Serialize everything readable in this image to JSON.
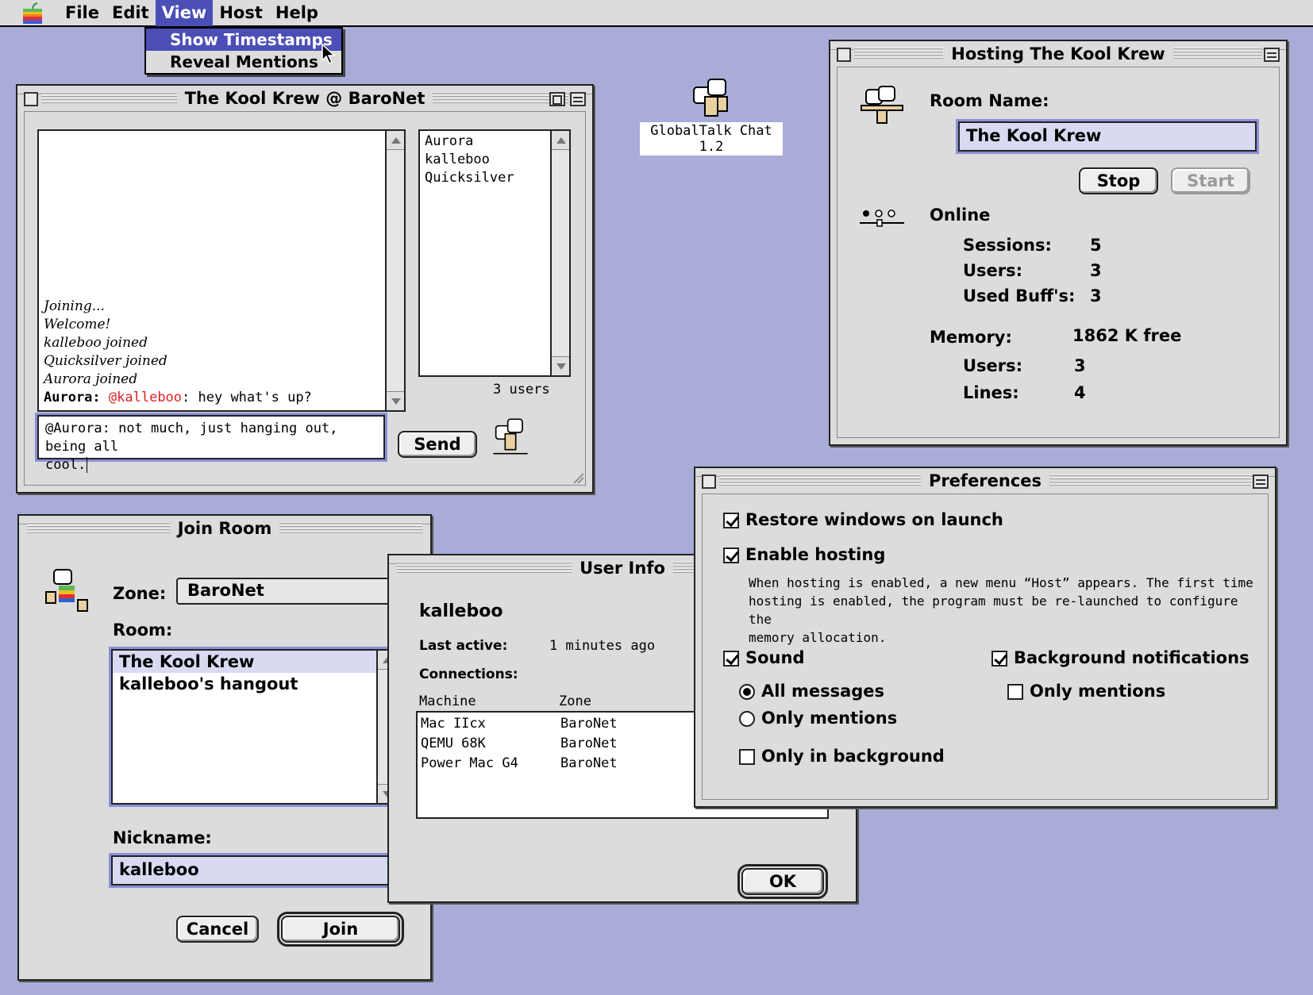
{
  "menubar": {
    "items": [
      "File",
      "Edit",
      "View",
      "Host",
      "Help"
    ],
    "active": "View",
    "view_menu": [
      "Show Timestamps",
      "Reveal Mentions"
    ]
  },
  "desktop_icon": {
    "label": "GlobalTalk Chat 1.2"
  },
  "chat_window": {
    "title": "The Kool Krew @ BaroNet",
    "log": [
      "Joining...",
      "Welcome!",
      "kalleboo joined",
      "Quicksilver joined",
      "Aurora joined"
    ],
    "last_message": {
      "sender": "Aurora:",
      "mention": "@kalleboo",
      "text": ": hey what's up?"
    },
    "users": [
      "Aurora",
      "kalleboo",
      "Quicksilver"
    ],
    "user_count": "3 users",
    "input_line1": "@Aurora: not much, just hanging out, being all",
    "input_line2": "cool.",
    "send_label": "Send"
  },
  "host_window": {
    "title": "Hosting The Kool Krew",
    "room_name_label": "Room Name:",
    "room_name_value": "The Kool Krew",
    "stop_label": "Stop",
    "start_label": "Start",
    "online_label": "Online",
    "sessions_label": "Sessions:",
    "sessions_value": "5",
    "users_label": "Users:",
    "users_value": "3",
    "buffs_label": "Used Buff's:",
    "buffs_value": "3",
    "memory_label": "Memory:",
    "memory_value": "1862 K free",
    "mem_users_label": "Users:",
    "mem_users_value": "3",
    "lines_label": "Lines:",
    "lines_value": "4"
  },
  "join_window": {
    "title": "Join Room",
    "zone_label": "Zone:",
    "zone_value": "BaroNet",
    "room_label": "Room:",
    "rooms": [
      "The Kool Krew",
      "kalleboo's hangout"
    ],
    "nickname_label": "Nickname:",
    "nickname_value": "kalleboo",
    "cancel_label": "Cancel",
    "join_label": "Join"
  },
  "userinfo_window": {
    "title": "User Info",
    "user": "kalleboo",
    "last_active_label": "Last active:",
    "last_active_value": "1 minutes ago",
    "connections_label": "Connections:",
    "col_machine": "Machine",
    "col_zone": "Zone",
    "rows": [
      [
        "Mac IIcx",
        "BaroNet"
      ],
      [
        "QEMU 68K",
        "BaroNet"
      ],
      [
        "Power Mac G4",
        "BaroNet"
      ]
    ],
    "ok_label": "OK"
  },
  "prefs_window": {
    "title": "Preferences",
    "restore_label": "Restore windows on launch",
    "hosting_label": "Enable hosting",
    "hosting_note_1": "When hosting is enabled, a new menu “Host” appears. The first time",
    "hosting_note_2": "hosting is enabled, the program must be re-launched to configure the",
    "hosting_note_3": "memory allocation.",
    "sound_label": "Sound",
    "all_messages_label": "All messages",
    "only_mentions_label": "Only mentions",
    "only_background_label": "Only in background",
    "bg_notif_label": "Background notifications",
    "bg_only_mentions_label": "Only mentions"
  }
}
